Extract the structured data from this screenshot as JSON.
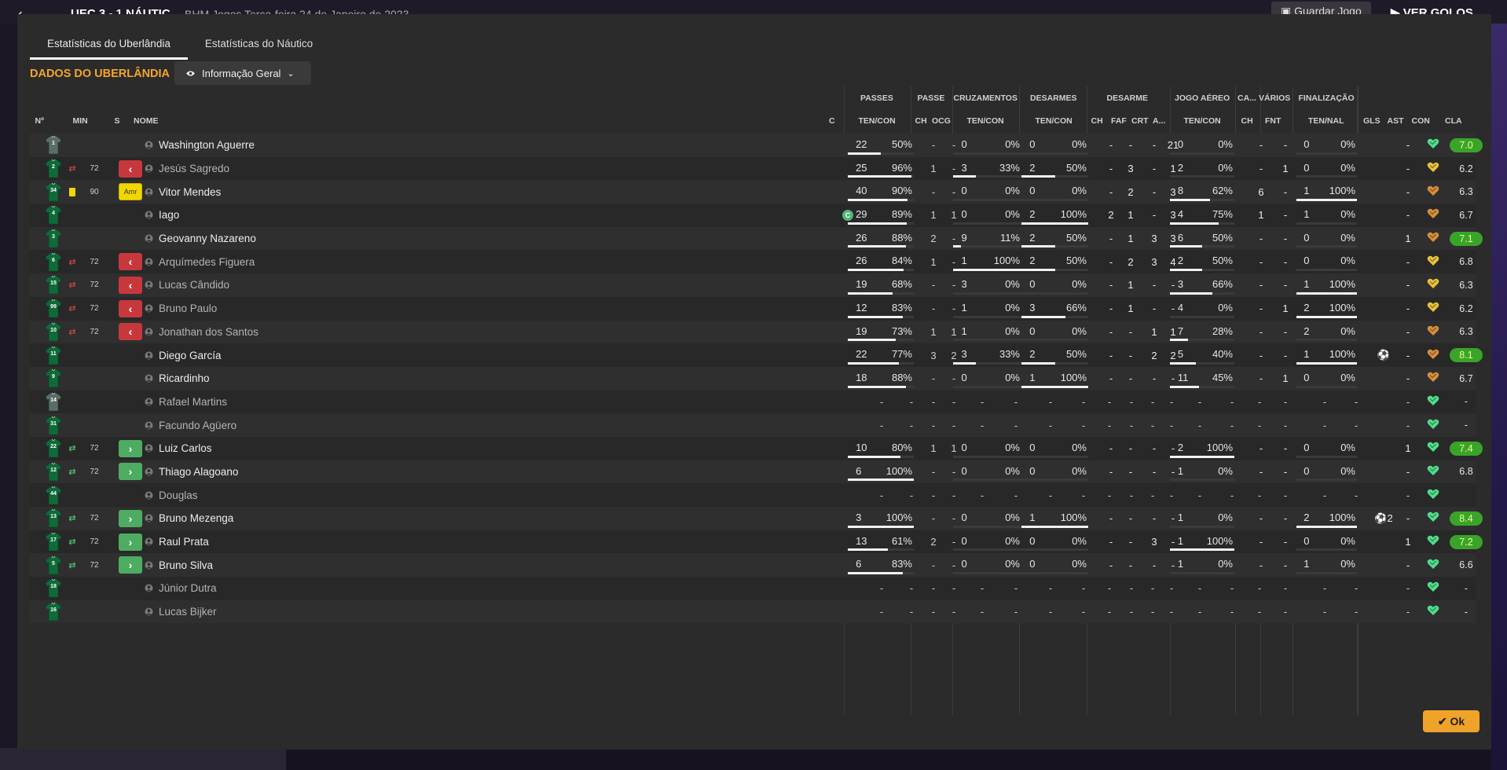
{
  "background": {
    "back_glyph": "⟵",
    "title": "UEC  3 - 1  NÁUTIC",
    "subtitle": "BHM Jogos     Terça-feira 24 de Janeiro de 2023",
    "save_button": "Guardar Jogo",
    "goals_button": "VER GOLOS"
  },
  "tabs": [
    {
      "label": "Estatísticas do Uberlândia",
      "active": true
    },
    {
      "label": "Estatísticas do Náutico",
      "active": false
    }
  ],
  "section_title": "DADOS DO UBERLÂNDIA",
  "view_select": {
    "label": "Informação Geral",
    "icon": "eye-icon"
  },
  "headers": {
    "groups": {
      "passes": "PASSES",
      "passe": "PASSE",
      "cruzamentos": "CRUZAMENTOS",
      "desarmes": "DESARMES",
      "desarme": "DESARME",
      "jogo_aereo": "JOGO AÉREO",
      "ca": "CA...",
      "varios": "VÁRIOS",
      "finalizacao": "FINALIZAÇÃO"
    },
    "columns": {
      "num": "Nº",
      "min": "MIN",
      "s": "S",
      "nome": "NOME",
      "c": "C",
      "passes_tc": "TEN/CON",
      "passe_ch": "CH",
      "passe_ocg": "OCG",
      "cruz_tc": "TEN/CON",
      "des_tc": "TEN/CON",
      "desarme_ch": "CH",
      "desarme_faf": "FAF",
      "desarme_crt": "CRT",
      "desarme_a": "A...",
      "aereo_tc": "TEN/CON",
      "ca_ch": "CH",
      "varios_fnt": "FNT",
      "fin_tn": "TEN/NAL",
      "gls": "GLS",
      "ast": "AST",
      "con": "CON",
      "cla": "CLA"
    }
  },
  "players": [
    {
      "num": "1",
      "gk": true,
      "subicon": "",
      "min": "",
      "badge": "",
      "name": "Washington Aguerre",
      "captain": false,
      "dim": false,
      "passes": [
        "22",
        "50%"
      ],
      "pf": 0.5,
      "passe": [
        "-",
        "-"
      ],
      "cruz": [
        "0",
        "0%"
      ],
      "cf": 0,
      "des": [
        "0",
        "0%"
      ],
      "df": 0,
      "desarme": [
        "-",
        "-",
        "-",
        "21"
      ],
      "aereo": [
        "0",
        "0%"
      ],
      "af": 0,
      "ca": "-",
      "fnt": "-",
      "fin": [
        "0",
        "0%"
      ],
      "ff": 0,
      "gls": "",
      "ast": "-",
      "rating": "7.0",
      "hi": true
    },
    {
      "num": "2",
      "gk": false,
      "subicon": "out",
      "min": "72",
      "badge": "out",
      "name": "Jesús Sagredo",
      "captain": false,
      "dim": true,
      "passes": [
        "25",
        "96%"
      ],
      "pf": 0.96,
      "passe": [
        "1",
        "-"
      ],
      "cruz": [
        "3",
        "33%"
      ],
      "cf": 0.33,
      "des": [
        "2",
        "50%"
      ],
      "df": 0.5,
      "desarme": [
        "-",
        "3",
        "-",
        "1"
      ],
      "aereo": [
        "2",
        "0%"
      ],
      "af": 0,
      "ca": "-",
      "fnt": "1",
      "fin": [
        "0",
        "0%"
      ],
      "ff": 0,
      "gls": "",
      "ast": "-",
      "rating": "6.2",
      "hi": false
    },
    {
      "num": "34",
      "gk": false,
      "subicon": "yellow",
      "min": "90",
      "badge": "amr",
      "name": "Vitor Mendes",
      "captain": false,
      "dim": false,
      "passes": [
        "40",
        "90%"
      ],
      "pf": 0.9,
      "passe": [
        "-",
        "-"
      ],
      "cruz": [
        "0",
        "0%"
      ],
      "cf": 0,
      "des": [
        "0",
        "0%"
      ],
      "df": 0,
      "desarme": [
        "-",
        "2",
        "-",
        "3"
      ],
      "aereo": [
        "8",
        "62%"
      ],
      "af": 0.62,
      "ca": "6",
      "fnt": "-",
      "fin": [
        "1",
        "100%"
      ],
      "ff": 1,
      "gls": "",
      "ast": "-",
      "rating": "6.3",
      "hi": false
    },
    {
      "num": "4",
      "gk": false,
      "subicon": "",
      "min": "",
      "badge": "",
      "name": "Iago",
      "captain": true,
      "dim": false,
      "passes": [
        "29",
        "89%"
      ],
      "pf": 0.89,
      "passe": [
        "1",
        "1"
      ],
      "cruz": [
        "0",
        "0%"
      ],
      "cf": 0,
      "des": [
        "2",
        "100%"
      ],
      "df": 1,
      "desarme": [
        "2",
        "1",
        "-",
        "3"
      ],
      "aereo": [
        "4",
        "75%"
      ],
      "af": 0.75,
      "ca": "1",
      "fnt": "-",
      "fin": [
        "1",
        "0%"
      ],
      "ff": 0,
      "gls": "",
      "ast": "-",
      "rating": "6.7",
      "hi": false
    },
    {
      "num": "3",
      "gk": false,
      "subicon": "",
      "min": "",
      "badge": "",
      "name": "Geovanny Nazareno",
      "captain": false,
      "dim": false,
      "passes": [
        "26",
        "88%"
      ],
      "pf": 0.88,
      "passe": [
        "2",
        "-"
      ],
      "cruz": [
        "9",
        "11%"
      ],
      "cf": 0.11,
      "des": [
        "2",
        "50%"
      ],
      "df": 0.5,
      "desarme": [
        "-",
        "1",
        "3",
        "3"
      ],
      "aereo": [
        "6",
        "50%"
      ],
      "af": 0.5,
      "ca": "-",
      "fnt": "-",
      "fin": [
        "0",
        "0%"
      ],
      "ff": 0,
      "gls": "",
      "ast": "1",
      "rating": "7.1",
      "hi": true
    },
    {
      "num": "6",
      "gk": false,
      "subicon": "out",
      "min": "72",
      "badge": "out",
      "name": "Arquímedes Figuera",
      "captain": false,
      "dim": true,
      "passes": [
        "26",
        "84%"
      ],
      "pf": 0.84,
      "passe": [
        "1",
        "-"
      ],
      "cruz": [
        "1",
        "100%"
      ],
      "cf": 1,
      "des": [
        "2",
        "50%"
      ],
      "df": 0.5,
      "desarme": [
        "-",
        "2",
        "3",
        "4"
      ],
      "aereo": [
        "2",
        "50%"
      ],
      "af": 0.5,
      "ca": "-",
      "fnt": "-",
      "fin": [
        "0",
        "0%"
      ],
      "ff": 0,
      "gls": "",
      "ast": "-",
      "rating": "6.8",
      "hi": false
    },
    {
      "num": "15",
      "gk": false,
      "subicon": "out",
      "min": "72",
      "badge": "out",
      "name": "Lucas Cândido",
      "captain": false,
      "dim": true,
      "passes": [
        "19",
        "68%"
      ],
      "pf": 0.68,
      "passe": [
        "-",
        "-"
      ],
      "cruz": [
        "3",
        "0%"
      ],
      "cf": 0,
      "des": [
        "0",
        "0%"
      ],
      "df": 0,
      "desarme": [
        "-",
        "1",
        "-",
        "-"
      ],
      "aereo": [
        "3",
        "66%"
      ],
      "af": 0.66,
      "ca": "-",
      "fnt": "-",
      "fin": [
        "1",
        "100%"
      ],
      "ff": 1,
      "gls": "",
      "ast": "-",
      "rating": "6.3",
      "hi": false
    },
    {
      "num": "99",
      "gk": false,
      "subicon": "out",
      "min": "72",
      "badge": "out",
      "name": "Bruno Paulo",
      "captain": false,
      "dim": true,
      "passes": [
        "12",
        "83%"
      ],
      "pf": 0.83,
      "passe": [
        "-",
        "-"
      ],
      "cruz": [
        "1",
        "0%"
      ],
      "cf": 0,
      "des": [
        "3",
        "66%"
      ],
      "df": 0.66,
      "desarme": [
        "-",
        "1",
        "-",
        "-"
      ],
      "aereo": [
        "4",
        "0%"
      ],
      "af": 0,
      "ca": "-",
      "fnt": "1",
      "fin": [
        "2",
        "100%"
      ],
      "ff": 1,
      "gls": "",
      "ast": "-",
      "rating": "6.2",
      "hi": false
    },
    {
      "num": "10",
      "gk": false,
      "subicon": "out",
      "min": "72",
      "badge": "out",
      "name": "Jonathan dos Santos",
      "captain": false,
      "dim": true,
      "passes": [
        "19",
        "73%"
      ],
      "pf": 0.73,
      "passe": [
        "1",
        "1"
      ],
      "cruz": [
        "1",
        "0%"
      ],
      "cf": 0,
      "des": [
        "0",
        "0%"
      ],
      "df": 0,
      "desarme": [
        "-",
        "-",
        "1",
        "1"
      ],
      "aereo": [
        "7",
        "28%"
      ],
      "af": 0.28,
      "ca": "-",
      "fnt": "-",
      "fin": [
        "2",
        "0%"
      ],
      "ff": 0,
      "gls": "",
      "ast": "-",
      "rating": "6.3",
      "hi": false
    },
    {
      "num": "11",
      "gk": false,
      "subicon": "",
      "min": "",
      "badge": "",
      "name": "Diego García",
      "captain": false,
      "dim": false,
      "passes": [
        "22",
        "77%"
      ],
      "pf": 0.77,
      "passe": [
        "3",
        "2"
      ],
      "cruz": [
        "3",
        "33%"
      ],
      "cf": 0.33,
      "des": [
        "2",
        "50%"
      ],
      "df": 0.5,
      "desarme": [
        "-",
        "-",
        "2",
        "2"
      ],
      "aereo": [
        "5",
        "40%"
      ],
      "af": 0.4,
      "ca": "-",
      "fnt": "-",
      "fin": [
        "1",
        "100%"
      ],
      "ff": 1,
      "gls": "ball",
      "ast": "-",
      "rating": "8.1",
      "hi": true
    },
    {
      "num": "9",
      "gk": false,
      "subicon": "",
      "min": "",
      "badge": "",
      "name": "Ricardinho",
      "captain": false,
      "dim": false,
      "passes": [
        "18",
        "88%"
      ],
      "pf": 0.88,
      "passe": [
        "-",
        "-"
      ],
      "cruz": [
        "0",
        "0%"
      ],
      "cf": 0,
      "des": [
        "1",
        "100%"
      ],
      "df": 1,
      "desarme": [
        "-",
        "-",
        "-",
        "-"
      ],
      "aereo": [
        "11",
        "45%"
      ],
      "af": 0.45,
      "ca": "-",
      "fnt": "1",
      "fin": [
        "0",
        "0%"
      ],
      "ff": 0,
      "gls": "",
      "ast": "-",
      "rating": "6.7",
      "hi": false
    },
    {
      "num": "14",
      "gk": true,
      "subicon": "",
      "min": "",
      "badge": "",
      "name": "Rafael Martins",
      "captain": false,
      "dim": true,
      "empty": true,
      "rating": "-",
      "hi": false
    },
    {
      "num": "31",
      "gk": false,
      "subicon": "",
      "min": "",
      "badge": "",
      "name": "Facundo Agüero",
      "captain": false,
      "dim": true,
      "empty": true,
      "rating": "-",
      "hi": false
    },
    {
      "num": "22",
      "gk": false,
      "subicon": "in",
      "min": "72",
      "badge": "in",
      "name": "Luiz Carlos",
      "captain": false,
      "dim": false,
      "passes": [
        "10",
        "80%"
      ],
      "pf": 0.8,
      "passe": [
        "1",
        "1"
      ],
      "cruz": [
        "0",
        "0%"
      ],
      "cf": 0,
      "des": [
        "0",
        "0%"
      ],
      "df": 0,
      "desarme": [
        "-",
        "-",
        "-",
        "-"
      ],
      "aereo": [
        "2",
        "100%"
      ],
      "af": 1,
      "ca": "-",
      "fnt": "-",
      "fin": [
        "0",
        "0%"
      ],
      "ff": 0,
      "gls": "",
      "ast": "1",
      "rating": "7.4",
      "hi": true
    },
    {
      "num": "12",
      "gk": false,
      "subicon": "in",
      "min": "72",
      "badge": "in",
      "name": "Thiago Alagoano",
      "captain": false,
      "dim": false,
      "passes": [
        "6",
        "100%"
      ],
      "pf": 1,
      "passe": [
        "-",
        "-"
      ],
      "cruz": [
        "0",
        "0%"
      ],
      "cf": 0,
      "des": [
        "0",
        "0%"
      ],
      "df": 0,
      "desarme": [
        "-",
        "-",
        "-",
        "-"
      ],
      "aereo": [
        "1",
        "0%"
      ],
      "af": 0,
      "ca": "-",
      "fnt": "-",
      "fin": [
        "0",
        "0%"
      ],
      "ff": 0,
      "gls": "",
      "ast": "-",
      "rating": "6.8",
      "hi": false
    },
    {
      "num": "44",
      "gk": false,
      "subicon": "",
      "min": "",
      "badge": "",
      "name": "Douglas",
      "captain": false,
      "dim": true,
      "empty": true,
      "rating": "",
      "hi": false
    },
    {
      "num": "13",
      "gk": false,
      "subicon": "in",
      "min": "72",
      "badge": "in",
      "name": "Bruno Mezenga",
      "captain": false,
      "dim": false,
      "passes": [
        "3",
        "100%"
      ],
      "pf": 1,
      "passe": [
        "-",
        "-"
      ],
      "cruz": [
        "0",
        "0%"
      ],
      "cf": 0,
      "des": [
        "1",
        "100%"
      ],
      "df": 1,
      "desarme": [
        "-",
        "-",
        "-",
        "-"
      ],
      "aereo": [
        "1",
        "0%"
      ],
      "af": 0,
      "ca": "-",
      "fnt": "-",
      "fin": [
        "2",
        "100%"
      ],
      "ff": 1,
      "gls": "ball2",
      "ast": "-",
      "rating": "8.4",
      "hi": true
    },
    {
      "num": "17",
      "gk": false,
      "subicon": "in",
      "min": "72",
      "badge": "in",
      "name": "Raul Prata",
      "captain": false,
      "dim": false,
      "passes": [
        "13",
        "61%"
      ],
      "pf": 0.61,
      "passe": [
        "2",
        "-"
      ],
      "cruz": [
        "0",
        "0%"
      ],
      "cf": 0,
      "des": [
        "0",
        "0%"
      ],
      "df": 0,
      "desarme": [
        "-",
        "-",
        "3",
        "-"
      ],
      "aereo": [
        "1",
        "100%"
      ],
      "af": 1,
      "ca": "-",
      "fnt": "-",
      "fin": [
        "0",
        "0%"
      ],
      "ff": 0,
      "gls": "",
      "ast": "1",
      "rating": "7.2",
      "hi": true
    },
    {
      "num": "5",
      "gk": false,
      "subicon": "in",
      "min": "72",
      "badge": "in",
      "name": "Bruno Silva",
      "captain": false,
      "dim": false,
      "passes": [
        "6",
        "83%"
      ],
      "pf": 0.83,
      "passe": [
        "-",
        "-"
      ],
      "cruz": [
        "0",
        "0%"
      ],
      "cf": 0,
      "des": [
        "0",
        "0%"
      ],
      "df": 0,
      "desarme": [
        "-",
        "-",
        "-",
        "-"
      ],
      "aereo": [
        "1",
        "0%"
      ],
      "af": 0,
      "ca": "-",
      "fnt": "-",
      "fin": [
        "1",
        "0%"
      ],
      "ff": 0,
      "gls": "",
      "ast": "-",
      "rating": "6.6",
      "hi": false
    },
    {
      "num": "18",
      "gk": false,
      "subicon": "",
      "min": "",
      "badge": "",
      "name": "Júnior Dutra",
      "captain": false,
      "dim": true,
      "empty": true,
      "rating": "-",
      "hi": false
    },
    {
      "num": "16",
      "gk": false,
      "subicon": "",
      "min": "",
      "badge": "",
      "name": "Lucas Bijker",
      "captain": false,
      "dim": true,
      "empty": true,
      "rating": "-",
      "hi": false
    }
  ],
  "ok_button": "Ok",
  "goal_count_extra": "2",
  "colors": {
    "accent": "#f0a329",
    "title": "#f4a52b",
    "sub_out": "#c7383d",
    "sub_in": "#4dac61",
    "rating_hi": "#3aa42a"
  }
}
